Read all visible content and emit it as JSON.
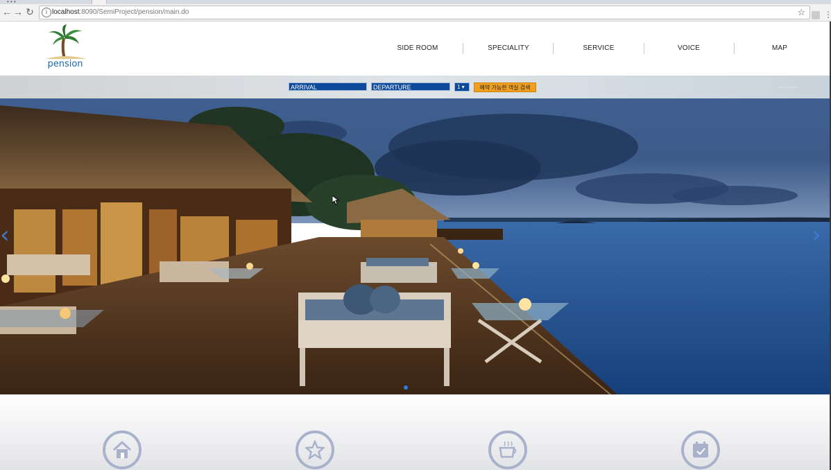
{
  "browser": {
    "url_host": "localhost",
    "url_rest": ":8090/SemiProject/pension/main.do"
  },
  "site": {
    "logo_text": "pension",
    "nav": [
      "SIDE ROOM",
      "SPECIALITY",
      "SERVICE",
      "VOICE",
      "MAP"
    ]
  },
  "search": {
    "arrival": "ARRIVAL",
    "departure": "DEPARTURE",
    "guests": "1",
    "button": "예약 가능한 객실 검색"
  },
  "hero": {
    "prev_arrow": "‹",
    "next_arrow": "›"
  },
  "features": [
    "home-icon",
    "star-icon",
    "coffee-icon",
    "calendar-icon"
  ],
  "colors": {
    "field_bg": "#0e4a9a",
    "button_bg": "#f0a020",
    "nav_text": "#222222",
    "feature_circle": "#a9b2cb",
    "carousel_active_dot": "#2a7de1"
  }
}
